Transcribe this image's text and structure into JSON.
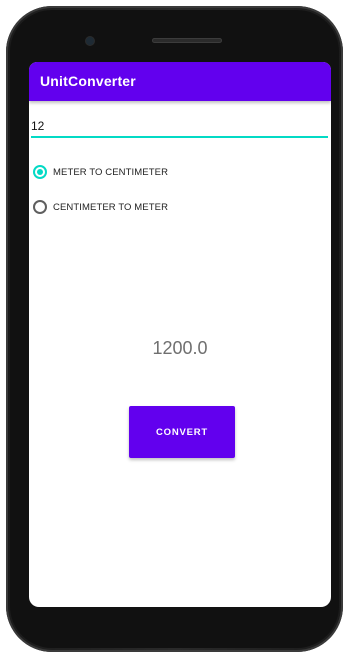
{
  "app_bar": {
    "title": "UnitConverter"
  },
  "input": {
    "value": "12",
    "placeholder": ""
  },
  "options": [
    {
      "label": "METER TO CENTIMETER",
      "checked": true
    },
    {
      "label": "CENTIMETER TO METER",
      "checked": false
    }
  ],
  "result": {
    "text": "1200.0"
  },
  "convert_button": {
    "label": "CONVERT"
  },
  "colors": {
    "primary": "#6200EE",
    "accent": "#03DAC5"
  }
}
